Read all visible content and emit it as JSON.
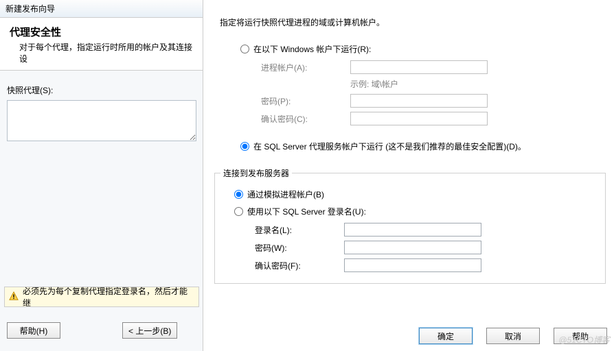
{
  "left": {
    "window_title": "新建发布向导",
    "header_title": "代理安全性",
    "header_subtitle": "对于每个代理，指定运行时所用的帐户及其连接设",
    "snapshot_label": "快照代理(S):",
    "snapshot_value": "",
    "warning_text": "必须先为每个复制代理指定登录名，然后才能继",
    "help_btn": "帮助(H)",
    "back_btn": "< 上一步(B)"
  },
  "right": {
    "instruction": "指定将运行快照代理进程的域或计算机帐户。",
    "opt_windows": "在以下 Windows 帐户下运行(R):",
    "process_account": "进程帐户(A):",
    "process_hint": "示例: 域\\帐户",
    "password": "密码(P):",
    "confirm_password": "确认密码(C):",
    "opt_sql_agent": "在 SQL Server 代理服务帐户下运行 (这不是我们推荐的最佳安全配置)(D)。",
    "conn": {
      "legend": "连接到发布服务器",
      "opt_impersonate": "通过模拟进程帐户(B)",
      "opt_sql_login": "使用以下 SQL Server 登录名(U):",
      "login": "登录名(L):",
      "password": "密码(W):",
      "confirm_password": "确认密码(F):"
    },
    "ok_btn": "确定",
    "cancel_btn": "取消",
    "help_btn": "帮助"
  },
  "watermark": "@51CTO博客"
}
